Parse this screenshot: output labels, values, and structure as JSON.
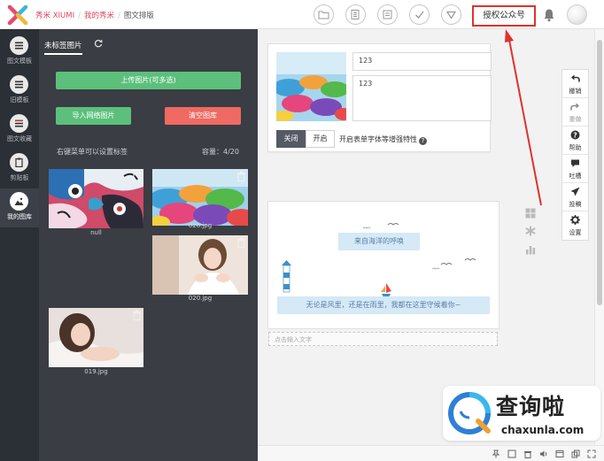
{
  "breadcrumb": {
    "brand": "秀米 XIUMI",
    "section": "我的秀米",
    "current": "图文排版"
  },
  "toolbar": {
    "auth_label": "授权公众号"
  },
  "leftnav": [
    {
      "label": "图文模板",
      "icon": "list-icon"
    },
    {
      "label": "旧模板",
      "icon": "list-icon"
    },
    {
      "label": "图文收藏",
      "icon": "list-icon"
    },
    {
      "label": "剪贴板",
      "icon": "clipboard-icon"
    },
    {
      "label": "我的图库",
      "icon": "image-icon",
      "active": true
    }
  ],
  "panel": {
    "tab": "未标签图片",
    "upload": "上传图片(可多选)",
    "import": "导入网络图片",
    "clear": "清空图库",
    "hint": "右键菜单可以设置标签",
    "capacity": "容量：4/20",
    "images": [
      {
        "caption": "null"
      },
      {
        "caption": "028.jpg"
      },
      {
        "caption": "020.jpg"
      },
      {
        "caption": "019.jpg"
      }
    ]
  },
  "editor": {
    "title_value": "123",
    "summary_value": "123",
    "switch_off": "关闭",
    "switch_on": "开启",
    "switch_label": "开启表单字体等增强特性",
    "bubble_top": "来自海洋的呼唤",
    "bubble_bottom": "无论是风里，还是在雨里，我都在这里守候着你~",
    "text_placeholder": "点击输入文字"
  },
  "right_tools": [
    {
      "label": "撤销",
      "icon": "undo-icon"
    },
    {
      "label": "重做",
      "icon": "redo-icon"
    },
    {
      "label": "帮助",
      "icon": "help-icon"
    },
    {
      "label": "吐槽",
      "icon": "comment-icon"
    },
    {
      "label": "投稿",
      "icon": "send-icon"
    },
    {
      "label": "设置",
      "icon": "gear-icon"
    }
  ],
  "watermark": {
    "title": "查询啦",
    "site": "chaxunla.com"
  },
  "colors": {
    "accent_red": "#e0322e",
    "green": "#5cc07c",
    "red_button": "#ee6a62",
    "dark_panel": "#3a3d43"
  }
}
